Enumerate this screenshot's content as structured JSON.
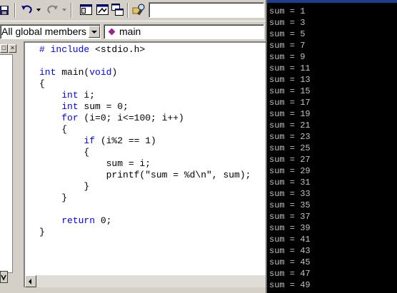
{
  "toolbar": {
    "icons": [
      "save-all-icon",
      "undo-icon",
      "redo-icon",
      "workspace-icon",
      "output-icon",
      "window-list-icon",
      "find-in-files-icon"
    ],
    "find_value": ""
  },
  "wizard_bar": {
    "members_combo": "All global members",
    "function_combo": "main"
  },
  "workspace": {
    "buttons": [
      "□",
      "×"
    ]
  },
  "editor": {
    "code_lines": [
      [
        {
          "t": "# include",
          "k": 1
        },
        {
          "t": " <stdio.h>",
          "k": 0
        }
      ],
      [],
      [
        {
          "t": "int",
          "k": 1
        },
        {
          "t": " main(",
          "k": 0
        },
        {
          "t": "void",
          "k": 1
        },
        {
          "t": ")",
          "k": 0
        }
      ],
      [
        {
          "t": "{",
          "k": 0
        }
      ],
      [
        {
          "t": "    ",
          "k": 0
        },
        {
          "t": "int",
          "k": 1
        },
        {
          "t": " i;",
          "k": 0
        }
      ],
      [
        {
          "t": "    ",
          "k": 0
        },
        {
          "t": "int",
          "k": 1
        },
        {
          "t": " sum = 0;",
          "k": 0
        }
      ],
      [
        {
          "t": "    ",
          "k": 0
        },
        {
          "t": "for",
          "k": 1
        },
        {
          "t": " (i=0; i<=100; i++)",
          "k": 0
        }
      ],
      [
        {
          "t": "    {",
          "k": 0
        }
      ],
      [
        {
          "t": "        ",
          "k": 0
        },
        {
          "t": "if",
          "k": 1
        },
        {
          "t": " (i%2 == 1)",
          "k": 0
        }
      ],
      [
        {
          "t": "        {",
          "k": 0
        }
      ],
      [
        {
          "t": "            sum = i;",
          "k": 0
        }
      ],
      [
        {
          "t": "            printf(\"sum = %d\\n\", sum);",
          "k": 0
        }
      ],
      [
        {
          "t": "        }",
          "k": 0
        }
      ],
      [
        {
          "t": "    }",
          "k": 0
        }
      ],
      [],
      [
        {
          "t": "    ",
          "k": 0
        },
        {
          "t": "return",
          "k": 1
        },
        {
          "t": " 0;",
          "k": 0
        }
      ],
      [
        {
          "t": "}",
          "k": 0
        }
      ]
    ],
    "keyword_color": "#0000ff"
  },
  "console": {
    "lines": [
      "sum = 1",
      "sum = 3",
      "sum = 5",
      "sum = 7",
      "sum = 9",
      "sum = 11",
      "sum = 13",
      "sum = 15",
      "sum = 17",
      "sum = 19",
      "sum = 21",
      "sum = 23",
      "sum = 25",
      "sum = 27",
      "sum = 29",
      "sum = 31",
      "sum = 33",
      "sum = 35",
      "sum = 37",
      "sum = 39",
      "sum = 41",
      "sum = 43",
      "sum = 45",
      "sum = 47",
      "sum = 49"
    ],
    "text_color": "#c0c0c0",
    "background": "#000000"
  }
}
